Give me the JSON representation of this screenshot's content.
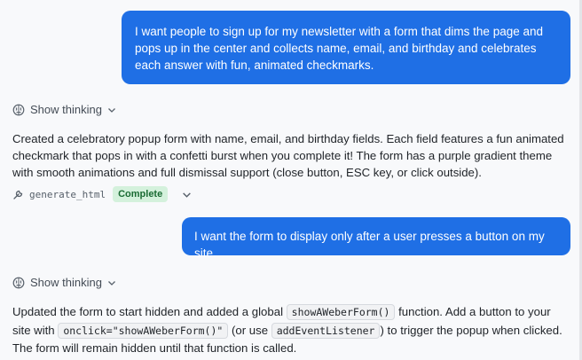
{
  "messages": {
    "user1": "I want people to sign up for my newsletter with a form that dims the page and pops up in the center and collects name, email, and birthday and celebrates each answer with fun, animated checkmarks.",
    "thinking_label_1": "Show thinking",
    "assistant1": "Created a celebratory popup form with name, email, and birthday fields. Each field features a fun animated checkmark that pops in with a confetti burst when you complete it! The form has a purple gradient theme with smooth animations and full dismissal support (close button, ESC key, or click outside).",
    "tool": {
      "name": "generate_html",
      "status": "Complete"
    },
    "user2": "I want the form to display only after a user presses a button on my site.",
    "thinking_label_2": "Show thinking",
    "assistant2": {
      "part1": "Updated the form to start hidden and added a global ",
      "code1": "showAWeberForm()",
      "part2": " function. Add a button to your site with ",
      "code2": "onclick=\"showAWeberForm()\"",
      "part3": " (or use ",
      "code3": "addEventListener",
      "part4": ") to trigger the popup when clicked. The form will remain hidden until that function is called."
    }
  },
  "colors": {
    "user_bubble": "#1f6fe5",
    "badge_bg": "#d4f1dc",
    "badge_text": "#1a6b33"
  },
  "icons": [
    "brain-icon",
    "chevron-down-icon",
    "wrench-icon"
  ]
}
